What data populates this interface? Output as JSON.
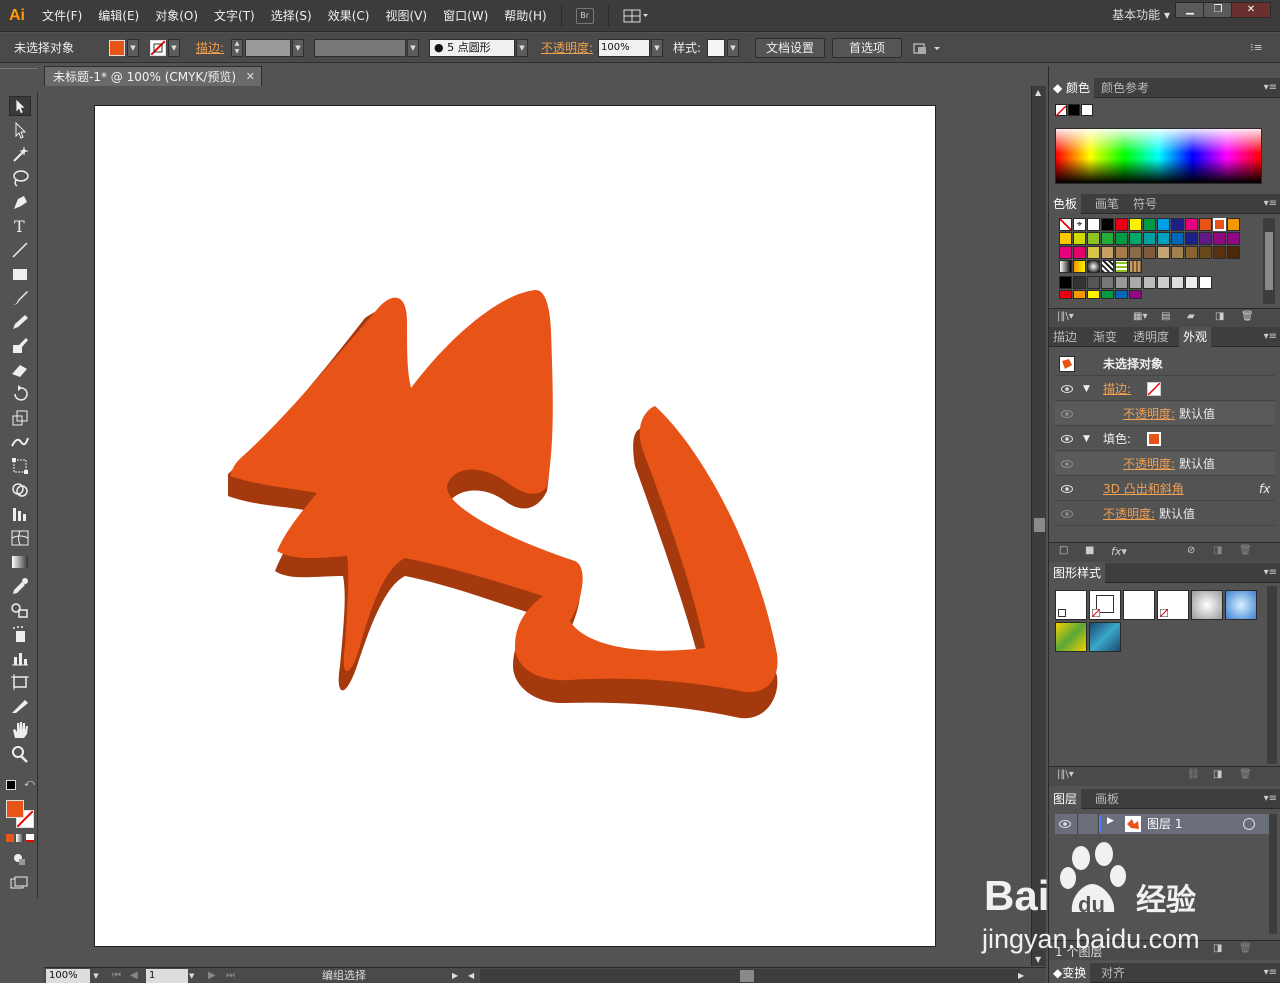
{
  "app": {
    "logo": "Ai",
    "workspace": "基本功能"
  },
  "menu": [
    "文件(F)",
    "编辑(E)",
    "对象(O)",
    "文字(T)",
    "选择(S)",
    "效果(C)",
    "视图(V)",
    "窗口(W)",
    "帮助(H)"
  ],
  "bridge_label": "Br",
  "control": {
    "selection": "未选择对象",
    "stroke_label": "描边",
    "brush": "5 点圆形",
    "opacity_label": "不透明度",
    "opacity_value": "100%",
    "style_label": "样式",
    "doc_setup": "文档设置",
    "prefs": "首选项"
  },
  "document": {
    "tab_title": "未标题-1* @ 100% (CMYK/预览)"
  },
  "status": {
    "zoom": "100%",
    "artboard": "1",
    "tool": "编组选择"
  },
  "colors": {
    "fill": "#E85318",
    "extrude": "#A5390E",
    "accent": "#f0a050"
  },
  "color_panel": {
    "tabs": [
      "颜色",
      "颜色参考"
    ]
  },
  "swatch_panel": {
    "tabs": [
      "色板",
      "画笔",
      "符号"
    ]
  },
  "appearance_panel": {
    "tabs": [
      "描边",
      "渐变",
      "透明度",
      "外观"
    ],
    "title": "未选择对象",
    "rows": [
      {
        "label": "描边:"
      },
      {
        "label": "不透明度:",
        "value": "默认值"
      },
      {
        "label": "填色:"
      },
      {
        "label": "不透明度:",
        "value": "默认值"
      },
      {
        "label": "3D 凸出和斜角",
        "value": "fx"
      },
      {
        "label": "不透明度:",
        "value": "默认值"
      }
    ]
  },
  "graphic_styles_panel": {
    "title": "图形样式"
  },
  "layers_panel": {
    "tabs": [
      "图层",
      "画板"
    ],
    "layer_name": "图层 1",
    "footer": "1 个图层"
  },
  "bottom_panel": {
    "tabs": [
      "变换",
      "对齐"
    ]
  },
  "watermark": {
    "brand": "Bai du 经验",
    "url": "jingyan.baidu.com"
  }
}
